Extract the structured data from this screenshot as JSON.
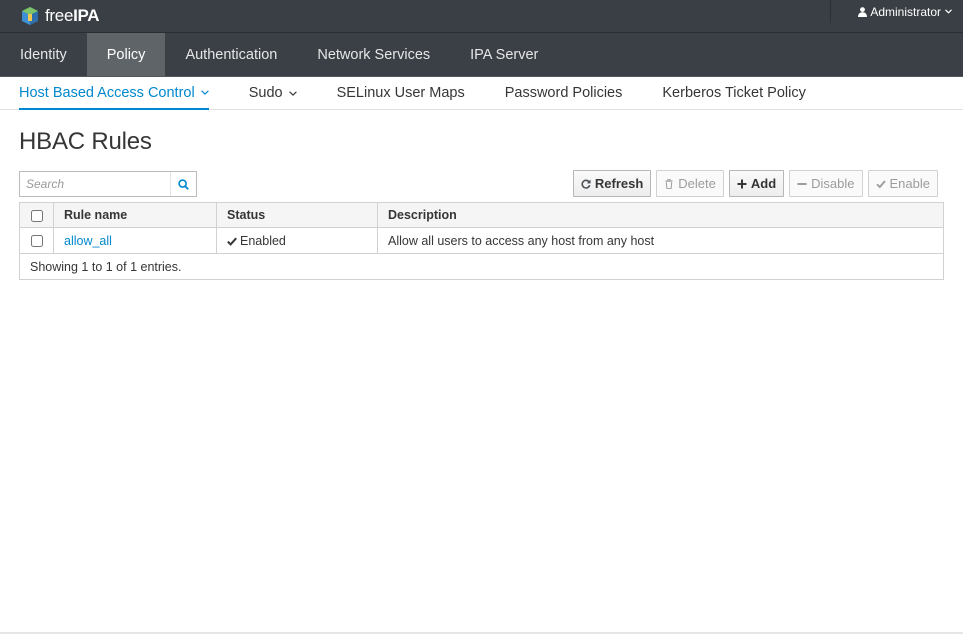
{
  "brand": {
    "text_light": "free",
    "text_bold": "IPA"
  },
  "user_menu": {
    "label": "Administrator"
  },
  "primary_nav": [
    {
      "label": "Identity",
      "active": false
    },
    {
      "label": "Policy",
      "active": true
    },
    {
      "label": "Authentication",
      "active": false
    },
    {
      "label": "Network Services",
      "active": false
    },
    {
      "label": "IPA Server",
      "active": false
    }
  ],
  "secondary_nav": [
    {
      "label": "Host Based Access Control",
      "active": true,
      "dropdown": true
    },
    {
      "label": "Sudo",
      "active": false,
      "dropdown": true
    },
    {
      "label": "SELinux User Maps",
      "active": false,
      "dropdown": false
    },
    {
      "label": "Password Policies",
      "active": false,
      "dropdown": false
    },
    {
      "label": "Kerberos Ticket Policy",
      "active": false,
      "dropdown": false
    }
  ],
  "page": {
    "title": "HBAC Rules"
  },
  "search": {
    "placeholder": "Search",
    "value": ""
  },
  "toolbar": {
    "refresh_label": "Refresh",
    "delete_label": "Delete",
    "add_label": "Add",
    "disable_label": "Disable",
    "enable_label": "Enable"
  },
  "table": {
    "columns": [
      "Rule name",
      "Status",
      "Description"
    ],
    "rows": [
      {
        "name": "allow_all",
        "status": "Enabled",
        "description": "Allow all users to access any host from any host"
      }
    ],
    "footer": "Showing 1 to 1 of 1 entries."
  },
  "colors": {
    "topbar": "#393f44",
    "primary_nav": "#3a4046",
    "active_tab": "#5f6468",
    "link_accent": "#0088ce"
  }
}
